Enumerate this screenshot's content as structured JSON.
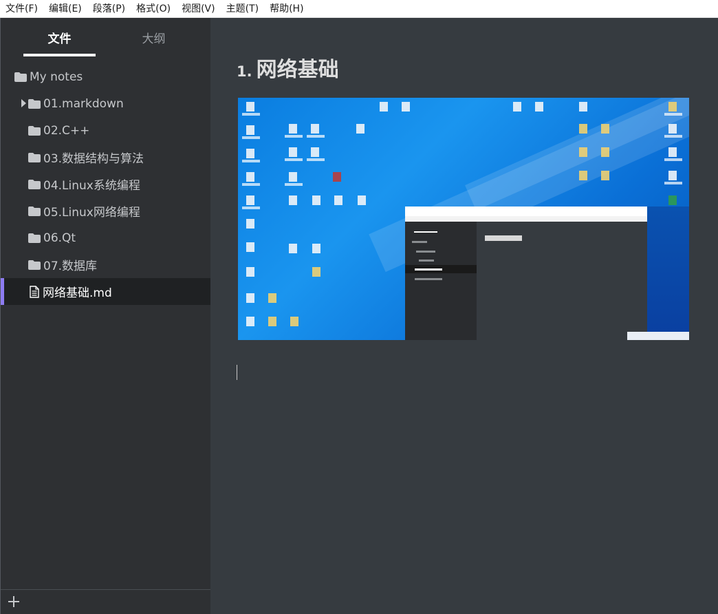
{
  "menubar": {
    "items": [
      "文件(F)",
      "编辑(E)",
      "段落(P)",
      "格式(O)",
      "视图(V)",
      "主题(T)",
      "帮助(H)"
    ]
  },
  "sidebar": {
    "tabs": {
      "files": "文件",
      "outline": "大纲"
    },
    "root": "My notes",
    "items": [
      {
        "label": "01.markdown",
        "type": "folder",
        "collapsed": true
      },
      {
        "label": "02.C++",
        "type": "folder"
      },
      {
        "label": "03.数据结构与算法",
        "type": "folder"
      },
      {
        "label": "04.Linux系统编程",
        "type": "folder"
      },
      {
        "label": "05.Linux网络编程",
        "type": "folder"
      },
      {
        "label": "06.Qt",
        "type": "folder"
      },
      {
        "label": "07.数据库",
        "type": "folder"
      },
      {
        "label": "网络基础.md",
        "type": "file",
        "active": true
      }
    ],
    "active_accent": "#8d7cf2"
  },
  "editor": {
    "heading_number": "1.",
    "heading_text": "网络基础",
    "image_description_icon": "embedded-desktop-screenshot"
  },
  "colors": {
    "sidebar_bg": "#2E3033",
    "editor_bg": "#363B40",
    "text": "#c6c8cb"
  }
}
